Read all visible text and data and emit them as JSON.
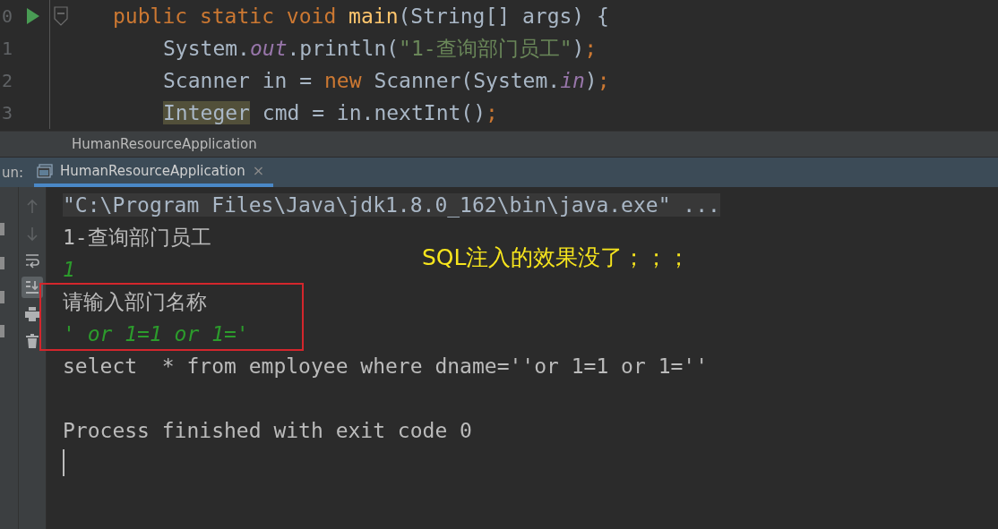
{
  "editor": {
    "lines": [
      {
        "number": "0",
        "run_marker": true,
        "fold_marker": true,
        "tokens": [
          {
            "kind": "keyword",
            "text": "public static void "
          },
          {
            "kind": "method",
            "text": "main"
          },
          {
            "kind": "plain",
            "text": "(String[] args) {"
          }
        ],
        "children": [
          {
            "number": "1",
            "run_marker": false,
            "fold_marker": false,
            "tokens": [
              {
                "kind": "plain",
                "text": "System."
              },
              {
                "kind": "field",
                "text": "out"
              },
              {
                "kind": "plain",
                "text": ".println("
              },
              {
                "kind": "string",
                "text": "\"1-查询部门员工\""
              },
              {
                "kind": "plain",
                "text": ")"
              },
              {
                "kind": "punct",
                "text": ";"
              }
            ]
          },
          {
            "number": "2",
            "run_marker": false,
            "fold_marker": false,
            "tokens": [
              {
                "kind": "plain",
                "text": "Scanner in = "
              },
              {
                "kind": "keyword",
                "text": "new "
              },
              {
                "kind": "plain",
                "text": "Scanner(System."
              },
              {
                "kind": "field",
                "text": "in"
              },
              {
                "kind": "plain",
                "text": ")"
              },
              {
                "kind": "punct",
                "text": ";"
              }
            ]
          },
          {
            "number": "3",
            "run_marker": false,
            "fold_marker": false,
            "tokens": [
              {
                "kind": "highlighted",
                "text": "Integer"
              },
              {
                "kind": "plain",
                "text": " cmd = in.nextInt()"
              },
              {
                "kind": "punct",
                "text": ";"
              }
            ]
          }
        ]
      }
    ]
  },
  "breadcrumb": "HumanResourceApplication",
  "run_panel": {
    "label": "un:",
    "tabs": [
      {
        "label": "HumanResourceApplication",
        "selected": true,
        "close": "×"
      }
    ]
  },
  "console_toolbar": [
    {
      "kind": "up",
      "disabled": true,
      "selected": false
    },
    {
      "kind": "down",
      "disabled": true,
      "selected": false
    },
    {
      "kind": "wrap",
      "disabled": false,
      "selected": false
    },
    {
      "kind": "scroll-end",
      "disabled": false,
      "selected": true
    },
    {
      "kind": "print",
      "disabled": false,
      "selected": false
    },
    {
      "kind": "trash",
      "disabled": false,
      "selected": false
    }
  ],
  "console": [
    {
      "kind": "command",
      "text": "\"C:\\Program Files\\Java\\jdk1.8.0_162\\bin\\java.exe\" ..."
    },
    {
      "kind": "output",
      "text": "1-查询部门员工"
    },
    {
      "kind": "input",
      "text": "1"
    },
    {
      "kind": "output",
      "text": "请输入部门名称"
    },
    {
      "kind": "input",
      "text": "' or 1=1 or 1='"
    },
    {
      "kind": "output",
      "text": "select  * from employee where dname=''or 1=1 or 1=''"
    },
    {
      "kind": "blank"
    },
    {
      "kind": "output",
      "text": "Process finished with exit code 0"
    },
    {
      "kind": "cursor"
    }
  ],
  "annotation": "SQL注入的效果没了；；；"
}
